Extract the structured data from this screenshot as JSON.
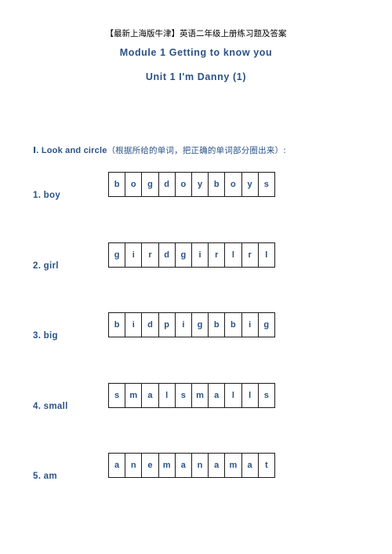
{
  "document": {
    "header_line": "【最新上海版牛津】英语二年级上册练习题及答案",
    "module_title": "Module 1   Getting to know you",
    "unit_title": "Unit 1   I'm Danny (1)"
  },
  "exercise": {
    "number": "Ⅰ.",
    "instruction_en": "Look and circle",
    "instruction_zh": "（根据所给的单词，把正确的单词部分圈出来）:",
    "items": [
      {
        "label": "1. boy",
        "word": "boy",
        "letters": [
          "b",
          "o",
          "g",
          "d",
          "o",
          "y",
          "b",
          "o",
          "y",
          "s"
        ]
      },
      {
        "label": "2. girl",
        "word": "girl",
        "letters": [
          "g",
          "i",
          "r",
          "d",
          "g",
          "i",
          "r",
          "l",
          "r",
          "l"
        ]
      },
      {
        "label": "3. big",
        "word": "big",
        "letters": [
          "b",
          "i",
          "d",
          "p",
          "i",
          "g",
          "b",
          "b",
          "i",
          "g"
        ]
      },
      {
        "label": "4. small",
        "word": "small",
        "letters": [
          "s",
          "m",
          "a",
          "l",
          "s",
          "m",
          "a",
          "l",
          "l",
          "s"
        ]
      },
      {
        "label": "5. am",
        "word": "am",
        "letters": [
          "a",
          "n",
          "e",
          "m",
          "a",
          "n",
          "a",
          "m",
          "a",
          "t"
        ]
      }
    ]
  },
  "colors": {
    "accent_blue": "#2b5287",
    "text_black": "#000000",
    "grid_border": "#1a1a1a",
    "page_background": "#ffffff"
  }
}
